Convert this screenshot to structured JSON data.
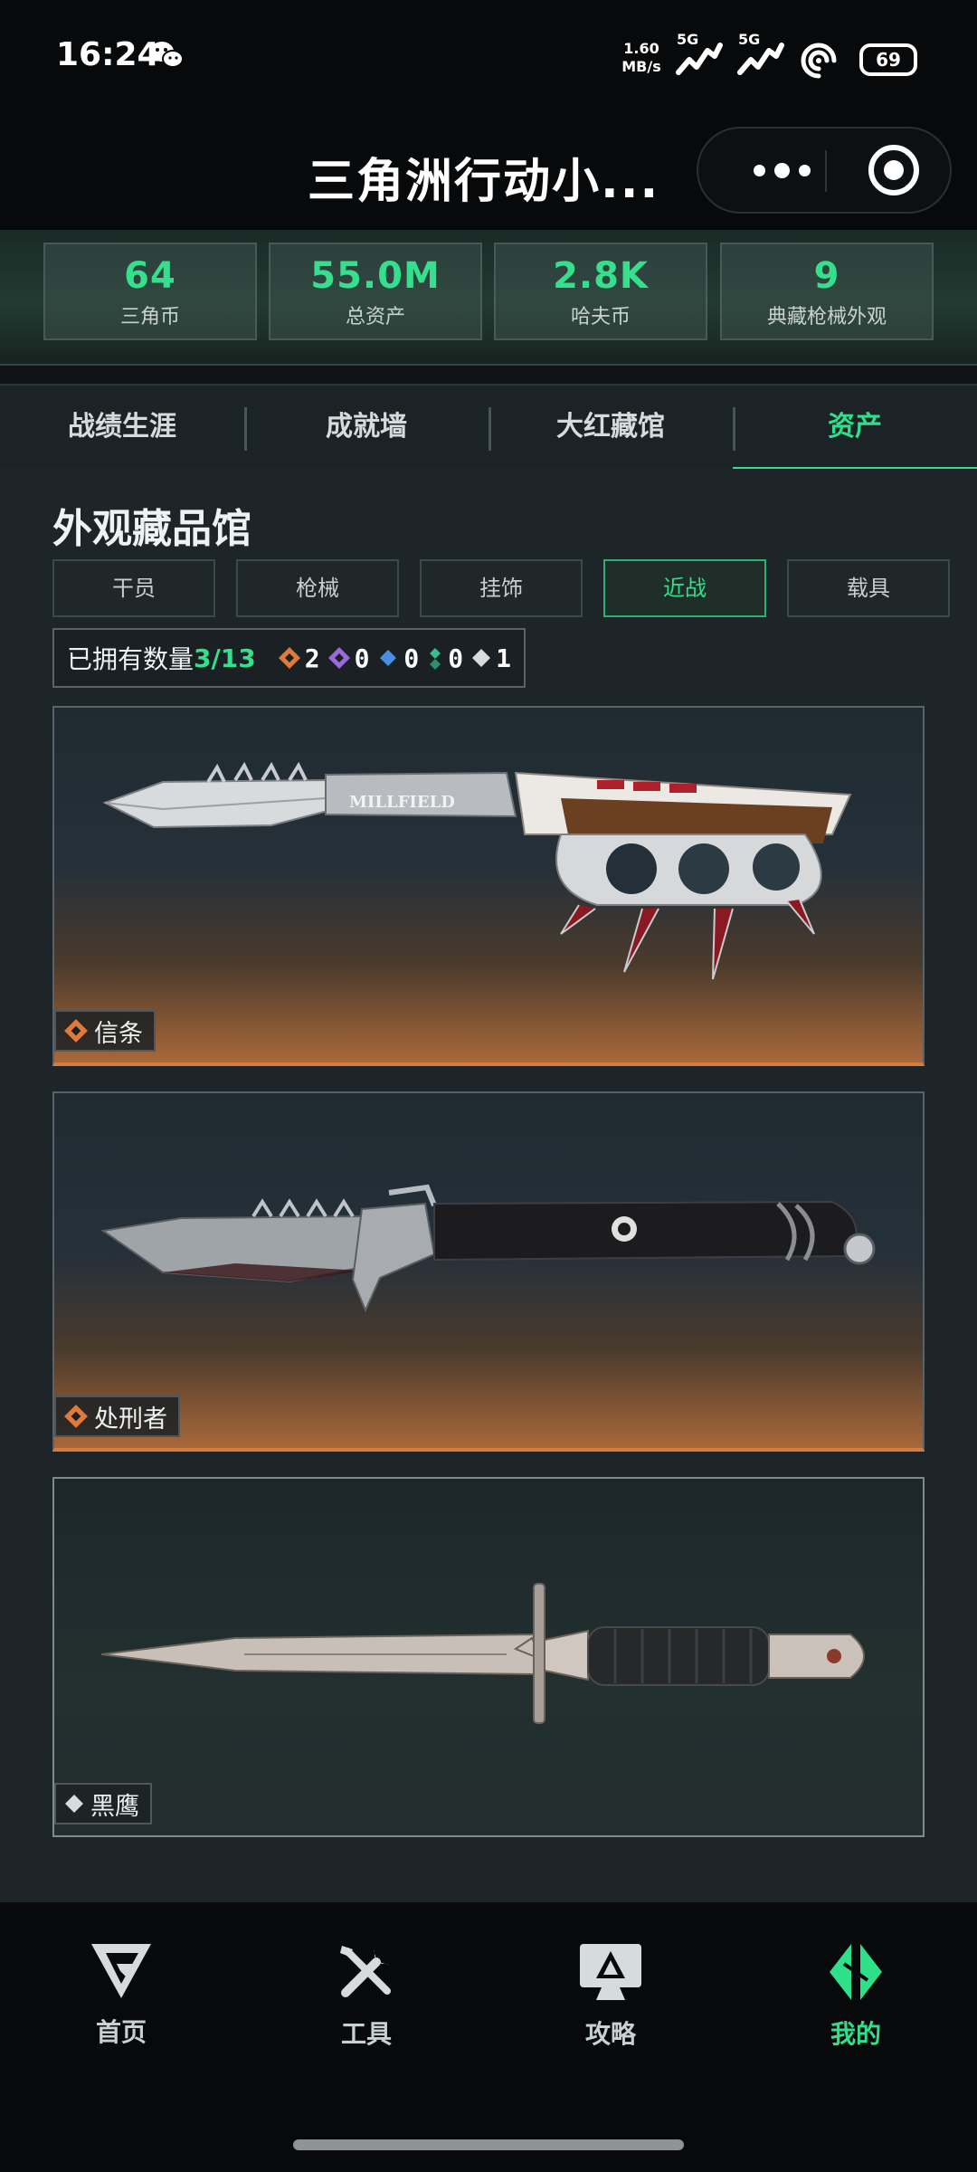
{
  "status_bar": {
    "time": "16:24",
    "net_speed_value": "1.60",
    "net_speed_unit": "MB/s",
    "signal1": "5G",
    "signal2": "5G",
    "battery": "69"
  },
  "header": {
    "title": "三角洲行动小..."
  },
  "stats": [
    {
      "value": "64",
      "label": "三角币"
    },
    {
      "value": "55.0M",
      "label": "总资产"
    },
    {
      "value": "2.8K",
      "label": "哈夫币"
    },
    {
      "value": "9",
      "label": "典藏枪械外观"
    }
  ],
  "tabs": [
    {
      "label": "战绩生涯",
      "active": false
    },
    {
      "label": "成就墙",
      "active": false
    },
    {
      "label": "大红藏馆",
      "active": false
    },
    {
      "label": "资产",
      "active": true
    }
  ],
  "section_title": "外观藏品馆",
  "filters": [
    {
      "label": "干员",
      "active": false
    },
    {
      "label": "枪械",
      "active": false
    },
    {
      "label": "挂饰",
      "active": false
    },
    {
      "label": "近战",
      "active": true
    },
    {
      "label": "载具",
      "active": false
    }
  ],
  "owned": {
    "label": "已拥有数量",
    "count": "3/13",
    "rarities": [
      {
        "name": "orange-diamond-icon",
        "color": "#e07a3a",
        "count": "2"
      },
      {
        "name": "purple-diamond-icon",
        "color": "#9a6ad8",
        "count": "0"
      },
      {
        "name": "blue-diamond-icon",
        "color": "#4a8ee0",
        "count": "0"
      },
      {
        "name": "green-diamond-icon",
        "color": "#35c08a",
        "count": "0"
      },
      {
        "name": "white-diamond-icon",
        "color": "#d8dcdc",
        "count": "1"
      }
    ]
  },
  "items": [
    {
      "name": "信条",
      "rarity": "orange",
      "rarity_color": "#e07a3a"
    },
    {
      "name": "处刑者",
      "rarity": "orange",
      "rarity_color": "#e07a3a"
    },
    {
      "name": "黑鹰",
      "rarity": "white",
      "rarity_color": "#d8dcdc"
    }
  ],
  "bottom_nav": [
    {
      "label": "首页",
      "icon": "home-logo-icon",
      "active": false
    },
    {
      "label": "工具",
      "icon": "tools-icon",
      "active": false
    },
    {
      "label": "攻略",
      "icon": "guide-icon",
      "active": false
    },
    {
      "label": "我的",
      "icon": "profile-logo-icon",
      "active": true
    }
  ],
  "colors": {
    "accent": "#2fe08a",
    "orange_rarity": "#e07a3a",
    "background": "#1e2528"
  }
}
